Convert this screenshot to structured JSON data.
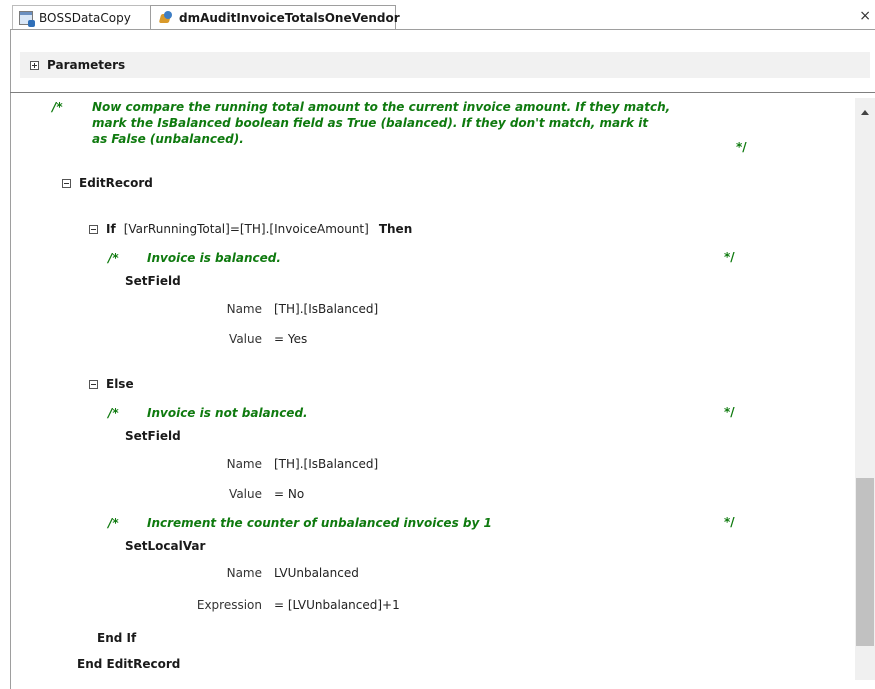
{
  "tabs": [
    {
      "label": "BOSSDataCopy",
      "icon": "form-icon"
    },
    {
      "label": "dmAuditInvoiceTotalsOneVendor",
      "icon": "macro-icon"
    }
  ],
  "close_symbol": "×",
  "parameters": {
    "expander": "+",
    "label": "Parameters"
  },
  "comment_top": {
    "marker": "/*",
    "lines": [
      "Now compare the running total amount to the current invoice amount. If they match,",
      "mark the IsBalanced boolean field as True (balanced). If they don't match, mark it",
      "as False (unbalanced)."
    ],
    "end": "*/"
  },
  "edit_record": {
    "label": "EditRecord",
    "end_label": "End EditRecord"
  },
  "if_block": {
    "keyword": "If",
    "condition": "[VarRunningTotal]=[TH].[InvoiceAmount]",
    "then": "Then",
    "comment": "Invoice is balanced.",
    "action": "SetField",
    "name_label": "Name",
    "name_value": "[TH].[IsBalanced]",
    "value_label": "Value",
    "value_value": "= Yes"
  },
  "else_block": {
    "keyword": "Else",
    "comment1": "Invoice is not balanced.",
    "action1": "SetField",
    "name_label": "Name",
    "name_value": "[TH].[IsBalanced]",
    "value_label": "Value",
    "value_value": "= No",
    "comment2": "Increment the counter of unbalanced invoices by 1",
    "action2": "SetLocalVar",
    "name2_label": "Name",
    "name2_value": "LVUnbalanced",
    "expr_label": "Expression",
    "expr_value": "= [LVUnbalanced]+1"
  },
  "end_if": "End If",
  "comment_marker": "/*",
  "comment_end": "*/"
}
